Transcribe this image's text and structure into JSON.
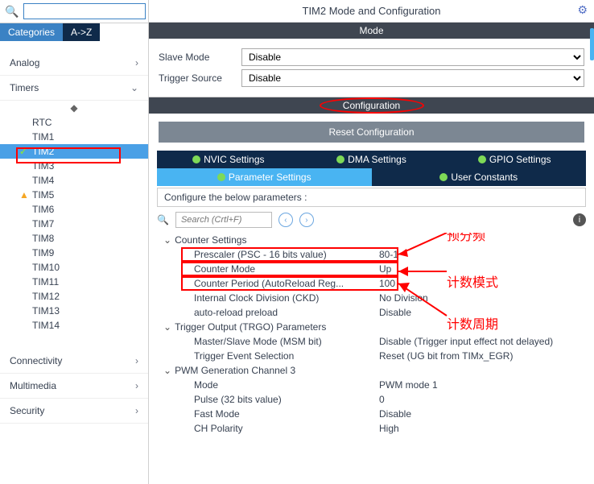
{
  "tabs": {
    "categories": "Categories",
    "az": "A->Z"
  },
  "cats": {
    "analog": "Analog",
    "timers": "Timers",
    "conn": "Connectivity",
    "multi": "Multimedia",
    "sec": "Security"
  },
  "timers": [
    "RTC",
    "TIM1",
    "TIM2",
    "TIM3",
    "TIM4",
    "TIM5",
    "TIM6",
    "TIM7",
    "TIM8",
    "TIM9",
    "TIM10",
    "TIM11",
    "TIM12",
    "TIM13",
    "TIM14"
  ],
  "title": "TIM2 Mode and Configuration",
  "bars": {
    "mode": "Mode",
    "config": "Configuration"
  },
  "mode": {
    "slave_label": "Slave Mode",
    "slave_val": "Disable",
    "trig_label": "Trigger Source",
    "trig_val": "Disable"
  },
  "reset": "Reset Configuration",
  "panetabs": {
    "nvic": "NVIC Settings",
    "dma": "DMA Settings",
    "gpio": "GPIO Settings",
    "param": "Parameter Settings",
    "user": "User Constants"
  },
  "hint": "Configure the below parameters :",
  "search_ph": "Search (Crtl+F)",
  "groups": {
    "counter": "Counter Settings",
    "trgo": "Trigger Output (TRGO) Parameters",
    "pwm": "PWM Generation Channel 3"
  },
  "kv": {
    "psc_k": "Prescaler (PSC - 16 bits value)",
    "psc_v": "80-1",
    "cm_k": "Counter Mode",
    "cm_v": "Up",
    "cp_k": "Counter Period (AutoReload Reg...",
    "cp_v": "100",
    "ckd_k": "Internal Clock Division (CKD)",
    "ckd_v": "No Division",
    "arp_k": "auto-reload preload",
    "arp_v": "Disable",
    "msm_k": "Master/Slave Mode (MSM bit)",
    "msm_v": "Disable (Trigger input effect not delayed)",
    "tes_k": "Trigger Event Selection",
    "tes_v": "Reset (UG bit from TIMx_EGR)",
    "pm_k": "Mode",
    "pm_v": "PWM mode 1",
    "pl_k": "Pulse (32 bits value)",
    "pl_v": "0",
    "fm_k": "Fast Mode",
    "fm_v": "Disable",
    "cp2_k": "CH Polarity",
    "cp2_v": "High"
  },
  "annot": {
    "pre": "预分频",
    "mode": "计数模式",
    "period": "计数周期"
  }
}
